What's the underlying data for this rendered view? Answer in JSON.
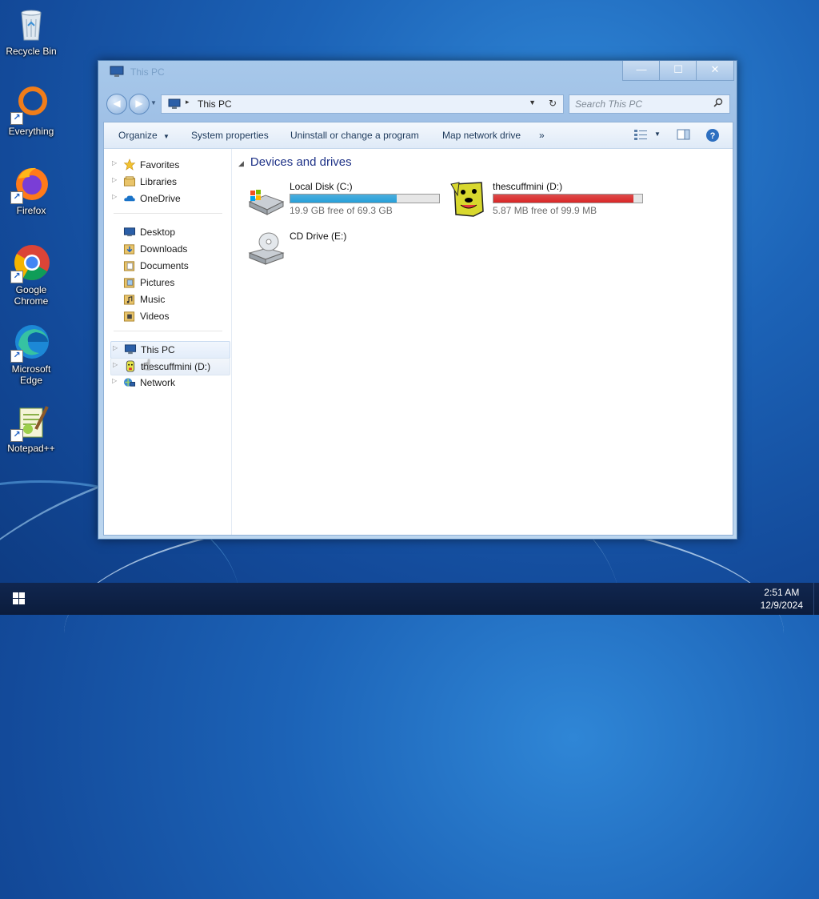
{
  "desktop": {
    "icons": [
      {
        "label": "Recycle Bin"
      },
      {
        "label": "Everything"
      },
      {
        "label": "Firefox"
      },
      {
        "label": "Google Chrome"
      },
      {
        "label": "Microsoft Edge"
      },
      {
        "label": "Notepad++"
      }
    ]
  },
  "window": {
    "title": "This PC",
    "controls": {
      "minimize": "—",
      "maximize": "☐",
      "close": "✕"
    },
    "address": {
      "path": "This PC",
      "separator": "▸"
    },
    "search": {
      "placeholder": "Search This PC"
    },
    "toolbar": {
      "organize": "Organize",
      "system_properties": "System properties",
      "uninstall": "Uninstall or change a program",
      "map_drive": "Map network drive",
      "more": "»"
    },
    "nav": {
      "favorites": "Favorites",
      "libraries": "Libraries",
      "onedrive": "OneDrive",
      "desktop": "Desktop",
      "downloads": "Downloads",
      "documents": "Documents",
      "pictures": "Pictures",
      "music": "Music",
      "videos": "Videos",
      "this_pc": "This PC",
      "d_drive": "thescuffmini (D:)",
      "network": "Network"
    },
    "content": {
      "group_title": "Devices and drives",
      "drives": [
        {
          "name": "Local Disk (C:)",
          "free_text": "19.9 GB free of 69.3 GB",
          "used_fraction": 0.713,
          "bar_color": "#26a0da"
        },
        {
          "name": "thescuffmini (D:)",
          "free_text": "5.87 MB free of 99.9 MB",
          "used_fraction": 0.941,
          "bar_color": "#da2626"
        },
        {
          "name": "CD Drive (E:)"
        }
      ]
    }
  },
  "taskbar": {
    "time": "2:51 AM",
    "date": "12/9/2024"
  }
}
